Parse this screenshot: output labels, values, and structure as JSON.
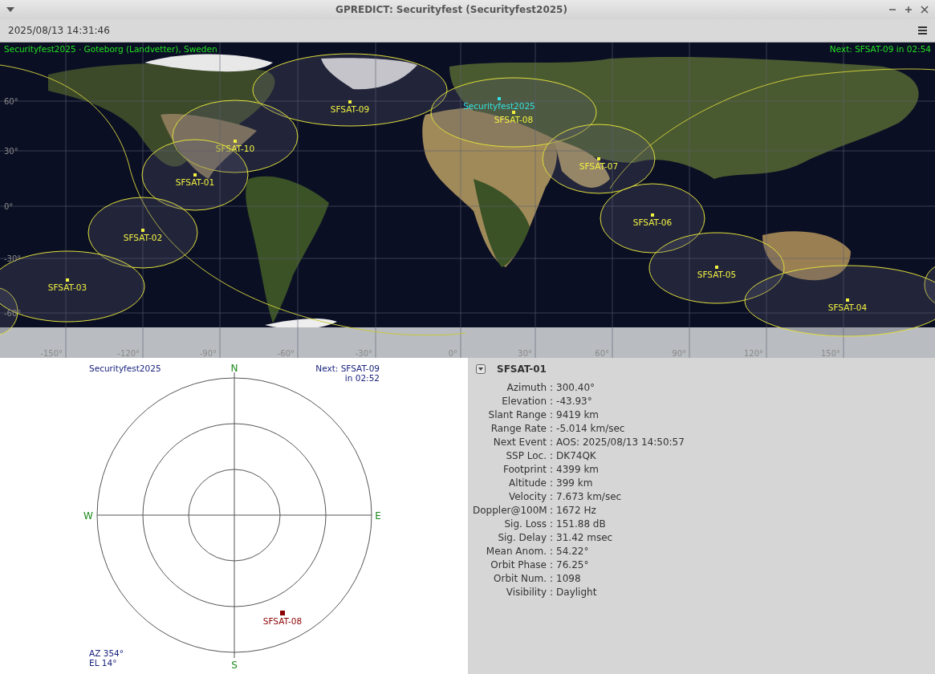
{
  "window": {
    "title": "GPREDICT: Securityfest (Securityfest2025)"
  },
  "toolbar": {
    "datetime": "2025/08/13 14:31:46"
  },
  "map": {
    "station_info": "Securityfest2025 · Goteborg (Landvetter), Sweden",
    "next_event": "Next: SFSAT-09 in 02:54",
    "ground_station": "Securityfest2025",
    "latitude_labels": [
      "60°",
      "30°",
      "0°",
      "-30°",
      "-60°"
    ],
    "longitude_labels": [
      "-150°",
      "-120°",
      "-90°",
      "-60°",
      "-30°",
      "0°",
      "30°",
      "60°",
      "90°",
      "120°",
      "150°"
    ],
    "satellites": [
      {
        "name": "SFSAT-09"
      },
      {
        "name": "SFSAT-08"
      },
      {
        "name": "SFSAT-10"
      },
      {
        "name": "SFSAT-01"
      },
      {
        "name": "SFSAT-07"
      },
      {
        "name": "SFSAT-06"
      },
      {
        "name": "SFSAT-02"
      },
      {
        "name": "SFSAT-05"
      },
      {
        "name": "SFSAT-03"
      },
      {
        "name": "SFSAT-04"
      }
    ]
  },
  "polar": {
    "station": "Securityfest2025",
    "next_event": [
      "Next: SFSAT-09",
      "in 02:52"
    ],
    "north": "N",
    "south": "S",
    "west": "W",
    "east": "E",
    "azimuth": "AZ 354°",
    "elevation": "EL 14°",
    "satellites": [
      {
        "name": "SFSAT-08"
      }
    ]
  },
  "details": {
    "satellite": "SFSAT-01",
    "fields": [
      {
        "label": "Azimuth",
        "separator": ":",
        "value": "300.40°"
      },
      {
        "label": "Elevation",
        "separator": ":",
        "value": "-43.93°"
      },
      {
        "label": "Slant Range",
        "separator": ":",
        "value": "9419 km"
      },
      {
        "label": "Range Rate",
        "separator": ":",
        "value": "-5.014 km/sec"
      },
      {
        "label": "Next Event",
        "separator": ":",
        "value": "AOS: 2025/08/13 14:50:57"
      },
      {
        "label": "SSP Loc.",
        "separator": ":",
        "value": "DK74QK"
      },
      {
        "label": "Footprint",
        "separator": ":",
        "value": "4399 km"
      },
      {
        "label": "Altitude",
        "separator": ":",
        "value": "399 km"
      },
      {
        "label": "Velocity",
        "separator": ":",
        "value": "7.673 km/sec"
      },
      {
        "label": "Doppler@100M",
        "separator": ":",
        "value": "1672 Hz"
      },
      {
        "label": "Sig. Loss",
        "separator": ":",
        "value": "151.88 dB"
      },
      {
        "label": "Sig. Delay",
        "separator": ":",
        "value": "31.42 msec"
      },
      {
        "label": "Mean Anom.",
        "separator": ":",
        "value": "54.22°"
      },
      {
        "label": "Orbit Phase",
        "separator": ":",
        "value": "76.25°"
      },
      {
        "label": "Orbit Num.",
        "separator": ":",
        "value": "1098"
      },
      {
        "label": "Visibility",
        "separator": ":",
        "value": "Daylight"
      }
    ]
  }
}
